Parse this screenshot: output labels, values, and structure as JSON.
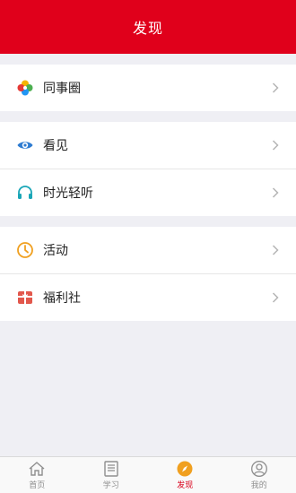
{
  "header": {
    "title": "发现"
  },
  "groups": [
    {
      "items": [
        {
          "label": "同事圈",
          "icon": "pinwheel-icon"
        }
      ]
    },
    {
      "items": [
        {
          "label": "看见",
          "icon": "eye-icon"
        },
        {
          "label": "时光轻听",
          "icon": "headphones-icon"
        }
      ]
    },
    {
      "items": [
        {
          "label": "活动",
          "icon": "clock-icon"
        },
        {
          "label": "福利社",
          "icon": "gift-icon"
        }
      ]
    }
  ],
  "tabbar": {
    "tabs": [
      {
        "label": "首页",
        "icon": "home-icon"
      },
      {
        "label": "学习",
        "icon": "book-icon"
      },
      {
        "label": "发现",
        "icon": "discover-icon",
        "active": true
      },
      {
        "label": "我的",
        "icon": "user-icon"
      }
    ]
  },
  "colors": {
    "accent": "#e0001b",
    "active_tab": "#d9001b"
  }
}
